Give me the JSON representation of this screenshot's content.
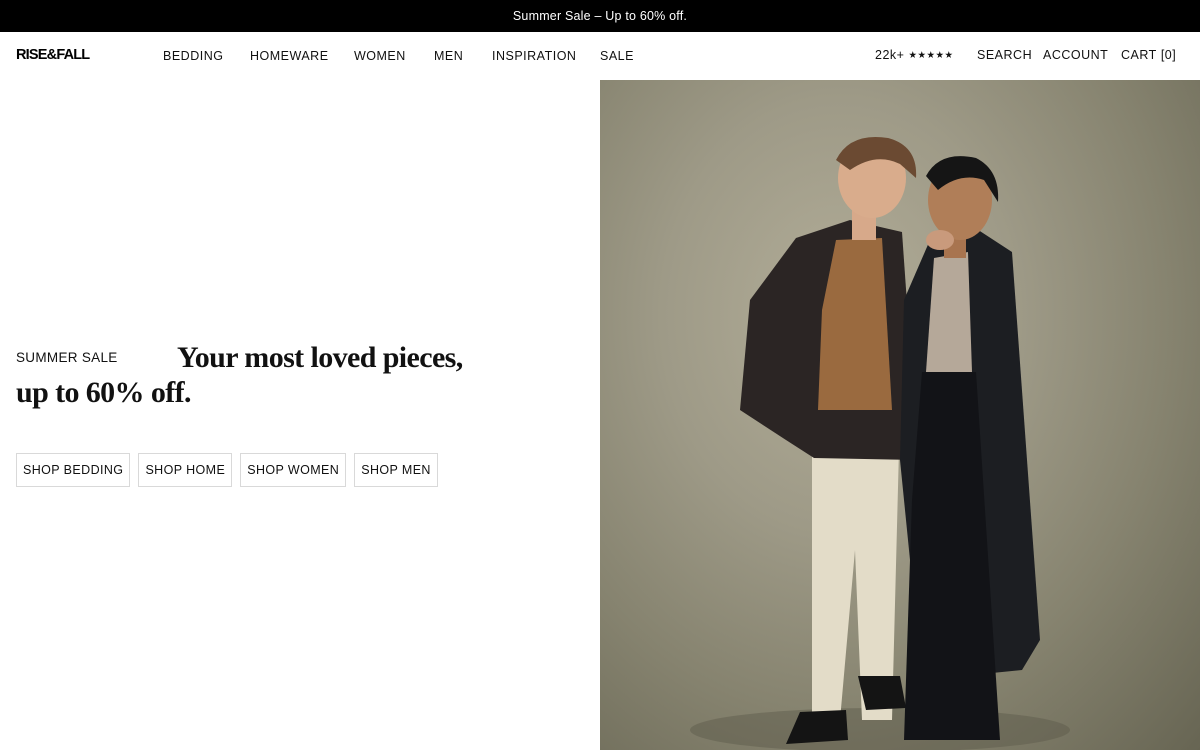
{
  "announcement": {
    "text": "Summer Sale – Up to 60% off."
  },
  "header": {
    "logo": "RISE&FALL",
    "nav": [
      "BEDDING",
      "HOMEWARE",
      "WOMEN",
      "MEN",
      "INSPIRATION",
      "SALE"
    ],
    "reviews": {
      "count": "22k+",
      "stars": "★★★★★"
    },
    "search": "SEARCH",
    "account": "ACCOUNT",
    "cart": {
      "label": "CART",
      "count": "[0]"
    }
  },
  "hero": {
    "eyebrow": "SUMMER SALE",
    "headline": "Your most loved pieces, up to 60% off.",
    "ctas": [
      "SHOP BEDDING",
      "SHOP HOME",
      "SHOP WOMEN",
      "SHOP MEN"
    ],
    "image": "couple-fashion-photo"
  }
}
